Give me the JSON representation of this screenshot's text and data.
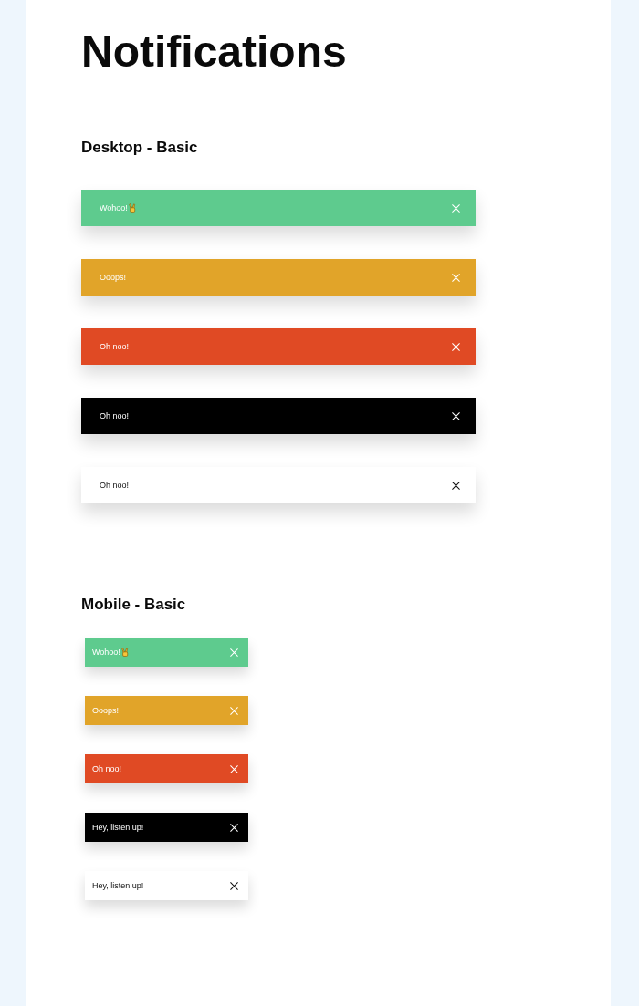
{
  "page": {
    "title": "Notifications"
  },
  "sections": [
    {
      "kind": "desktop",
      "title": "Desktop - Basic",
      "toasts": [
        {
          "text": "Wohoo!",
          "emoji": true,
          "color": "#5ecb8e"
        },
        {
          "text": "Ooops!",
          "emoji": false,
          "color": "#e1a429"
        },
        {
          "text": "Oh noo!",
          "emoji": false,
          "color": "#e04a24"
        },
        {
          "text": "Oh noo!",
          "emoji": false,
          "color": "#000000"
        },
        {
          "text": "Oh noo!",
          "emoji": false,
          "color": "#ffffff"
        }
      ]
    },
    {
      "kind": "mobile",
      "title": "Mobile - Basic",
      "toasts": [
        {
          "text": "Wohoo!",
          "emoji": true,
          "color": "#5ecb8e"
        },
        {
          "text": "Ooops!",
          "emoji": false,
          "color": "#e1a429"
        },
        {
          "text": "Oh noo!",
          "emoji": false,
          "color": "#e04a24"
        },
        {
          "text": "Hey, listen up!",
          "emoji": false,
          "color": "#000000"
        },
        {
          "text": "Hey, listen up!",
          "emoji": false,
          "color": "#ffffff"
        }
      ]
    }
  ]
}
